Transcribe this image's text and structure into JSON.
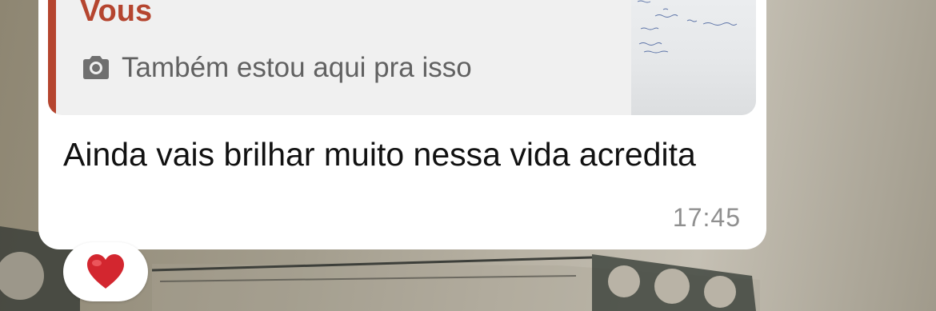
{
  "quoted_message": {
    "author": "Vous",
    "media_icon": "camera-icon",
    "text": "Também estou aqui pra isso",
    "thumbnail": "photo-thumbnail"
  },
  "message": {
    "text": "Ainda vais brilhar muito nessa vida acredita",
    "time": "17:45"
  },
  "reaction": {
    "emoji": "heart-icon"
  },
  "colors": {
    "quote_accent": "#b5452f",
    "bubble": "#ffffff",
    "quote_background": "#f0f0f0",
    "reaction_heart": "#d3262f"
  }
}
